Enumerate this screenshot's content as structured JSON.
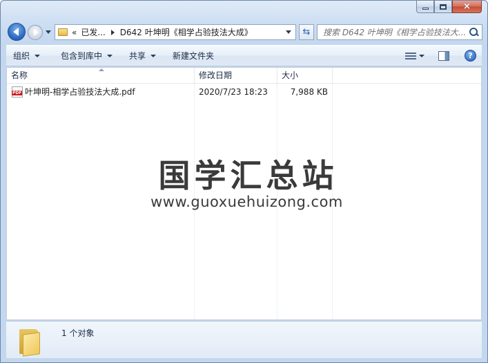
{
  "window": {
    "caption": {
      "minimize": "minimize",
      "maximize": "maximize",
      "close": "×"
    }
  },
  "nav": {
    "breadcrumb": {
      "overflow": "«",
      "items": [
        "已发...",
        "D642 叶坤明《相学占验技法大成》"
      ]
    },
    "refresh_icon": "⇆",
    "search_placeholder": "搜索 D642 叶坤明《相学占验技法大..."
  },
  "toolbar": {
    "organize": "组织",
    "include_in_library": "包含到库中",
    "share": "共享",
    "new_folder": "新建文件夹",
    "help": "?"
  },
  "columns": {
    "name": "名称",
    "date": "修改日期",
    "size": "大小"
  },
  "files": [
    {
      "icon": "pdf-icon",
      "badge": "PDF",
      "name": "叶坤明-相学占验技法大成.pdf",
      "date": "2020/7/23 18:23",
      "size": "7,988 KB"
    }
  ],
  "watermark": {
    "cn": "国学汇总站",
    "en": "www.guoxuehuizong.com"
  },
  "status": {
    "count": "1 个对象"
  },
  "colors": {
    "accent": "#2d6fc7",
    "pdf_badge": "#c7181d"
  }
}
